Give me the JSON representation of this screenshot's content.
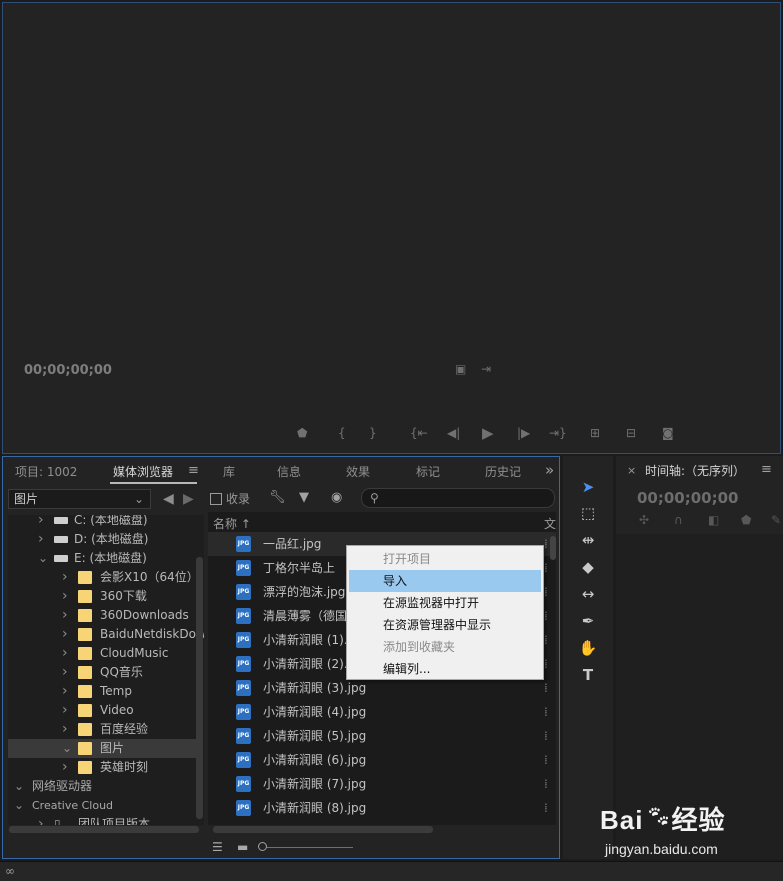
{
  "program_monitor": {
    "timecode": "00;00;00;00",
    "transport_icons": [
      "marker-icon",
      "mark-in-icon",
      "mark-out-icon",
      "go-to-in-icon",
      "step-back-icon",
      "play-icon",
      "step-forward-icon",
      "go-to-out-icon",
      "insert-icon",
      "overwrite-icon",
      "export-frame-icon"
    ]
  },
  "project_panel": {
    "tabs": [
      {
        "label": "项目: 1002",
        "active": false
      },
      {
        "label": "媒体浏览器",
        "active": true
      },
      {
        "label": "库",
        "active": false
      },
      {
        "label": "信息",
        "active": false
      },
      {
        "label": "效果",
        "active": false
      },
      {
        "label": "标记",
        "active": false
      },
      {
        "label": "历史记",
        "active": false
      }
    ],
    "menu_glyph": "≡",
    "overflow_glyph": "»",
    "location_dropdown": "图片",
    "favorites_label": "收录",
    "search_placeholder": "",
    "tree": [
      {
        "label": "C: (本地磁盘)",
        "kind": "drive",
        "level": 1,
        "expanded": false,
        "selected": false
      },
      {
        "label": "D: (本地磁盘)",
        "kind": "drive",
        "level": 1,
        "expanded": false,
        "selected": false
      },
      {
        "label": "E: (本地磁盘)",
        "kind": "drive",
        "level": 1,
        "expanded": true,
        "selected": false
      },
      {
        "label": "会影X10（64位）",
        "kind": "folder",
        "level": 2,
        "expanded": false,
        "selected": false
      },
      {
        "label": "360下载",
        "kind": "folder",
        "level": 2,
        "expanded": false,
        "selected": false
      },
      {
        "label": "360Downloads",
        "kind": "folder",
        "level": 2,
        "expanded": false,
        "selected": false
      },
      {
        "label": "BaiduNetdiskDown",
        "kind": "folder",
        "level": 2,
        "expanded": false,
        "selected": false
      },
      {
        "label": "CloudMusic",
        "kind": "folder",
        "level": 2,
        "expanded": false,
        "selected": false
      },
      {
        "label": "QQ音乐",
        "kind": "folder",
        "level": 2,
        "expanded": false,
        "selected": false
      },
      {
        "label": "Temp",
        "kind": "folder",
        "level": 2,
        "expanded": false,
        "selected": false
      },
      {
        "label": "Video",
        "kind": "folder",
        "level": 2,
        "expanded": false,
        "selected": false
      },
      {
        "label": "百度经验",
        "kind": "folder",
        "level": 2,
        "expanded": false,
        "selected": false
      },
      {
        "label": "图片",
        "kind": "folder",
        "level": 2,
        "expanded": true,
        "selected": true
      },
      {
        "label": "英雄时刻",
        "kind": "folder",
        "level": 2,
        "expanded": false,
        "selected": false
      },
      {
        "label": "网络驱动器",
        "kind": "section",
        "level": 0,
        "expanded": true,
        "selected": false
      },
      {
        "label": "Creative Cloud",
        "kind": "section",
        "level": 0,
        "expanded": true,
        "selected": false
      },
      {
        "label": "团队项目版本",
        "kind": "team",
        "level": 1,
        "expanded": false,
        "selected": false
      }
    ],
    "list": {
      "col_name": "名称",
      "col_type": "文",
      "files": [
        "一品红.jpg",
        "丁格尔半岛上",
        "漂浮的泡沫.jpg",
        "清晨薄雾（德国",
        "小清新润眼 (1).",
        "小清新润眼 (2).",
        "小清新润眼 (3).jpg",
        "小清新润眼 (4).jpg",
        "小清新润眼 (5).jpg",
        "小清新润眼 (6).jpg",
        "小清新润眼 (7).jpg",
        "小清新润眼 (8).jpg"
      ],
      "file_badge": "JPG"
    }
  },
  "context_menu": {
    "items": [
      {
        "label": "打开项目",
        "disabled": true,
        "highlighted": false
      },
      {
        "label": "导入",
        "disabled": false,
        "highlighted": true
      },
      {
        "label": "在源监视器中打开",
        "disabled": false,
        "highlighted": false
      },
      {
        "label": "在资源管理器中显示",
        "disabled": false,
        "highlighted": false
      },
      {
        "label": "添加到收藏夹",
        "disabled": true,
        "highlighted": false
      },
      {
        "label": "编辑列...",
        "disabled": false,
        "highlighted": false
      }
    ]
  },
  "tools": [
    "selection-tool-icon",
    "track-select-tool-icon",
    "ripple-edit-tool-icon",
    "razor-tool-icon",
    "slip-tool-icon",
    "pen-tool-icon",
    "hand-tool-icon",
    "type-tool-icon"
  ],
  "timeline": {
    "close_glyph": "×",
    "title": "时间轴:（无序列）",
    "menu_glyph": "≡",
    "timecode": "00;00;00;00"
  },
  "watermark": {
    "brand_left": "Bai",
    "brand_right": "经验",
    "url": "jingyan.baidu.com"
  },
  "colors": {
    "accent_blue": "#3769a6",
    "menu_highlight": "#99c9ef",
    "folder_yellow": "#f7d475",
    "active_tool": "#4c8ff0"
  }
}
